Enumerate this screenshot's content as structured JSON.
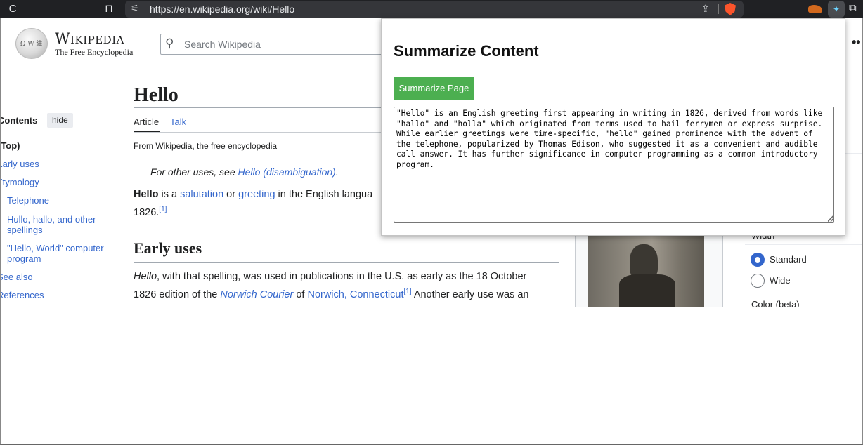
{
  "browser": {
    "url": "https://en.wikipedia.org/wiki/Hello",
    "reload_glyph": "C",
    "bookmark_glyph": "⊓",
    "tune_glyph": "⚟",
    "share_glyph": "⇪",
    "ext_active_glyph": "✦",
    "puzzle_glyph": "⧉",
    "icons": [
      "reload-icon",
      "bookmark-icon",
      "site-settings-icon",
      "share-icon",
      "brave-shield-icon",
      "extension-icon",
      "puzzle-icon"
    ]
  },
  "wiki": {
    "wordmark": "Wikipedia",
    "tagline": "The Free Encyclopedia",
    "search_placeholder": "Search Wikipedia",
    "more_glyph": "••",
    "toc": {
      "title": "Contents",
      "hide_label": "hide",
      "items": [
        "(Top)",
        "Early uses",
        "Etymology",
        "Telephone",
        "Hullo, hallo, and other spellings",
        "\"Hello, World\" computer program",
        "See also",
        "References"
      ]
    },
    "article": {
      "title": "Hello",
      "tab_article": "Article",
      "tab_talk": "Talk",
      "from": "From Wikipedia, the free encyclopedia",
      "hatnote_prefix": "For other uses, see ",
      "hatnote_link": "Hello (disambiguation)",
      "hatnote_suffix": ".",
      "lead_bold": "Hello",
      "lead_is": " is a ",
      "lead_link1": "salutation",
      "lead_or": " or ",
      "lead_link2": "greeting",
      "lead_rest": " in the English langua",
      "lead_year": "1826.",
      "ref1": "[1]",
      "section1": "Early uses",
      "p2_italic": "Hello",
      "p2_a": ", with that spelling, was used in publications in the U.S. as early as the 18 October",
      "p2_b": "1826 edition of the ",
      "p2_link_italic": "Norwich Courier",
      "p2_of": " of ",
      "p2_link": "Norwich, Connecticut",
      "p2_ref": "[1]",
      "p2_c": " Another early use was an"
    },
    "appearance": {
      "width_label": "Width",
      "option_standard": "Standard",
      "option_wide": "Wide",
      "color_label": "Color (beta)"
    }
  },
  "popup": {
    "title": "Summarize Content",
    "button_label": "Summarize Page",
    "summary": "\"Hello\" is an English greeting first appearing in writing in 1826, derived from words like\n\"hallo\" and \"holla\" which originated from terms used to hail ferrymen or express surprise.\nWhile earlier greetings were time-specific, \"hello\" gained prominence with the advent of\nthe telephone, popularized by Thomas Edison, who suggested it as a convenient and audible\ncall answer. It has further significance in computer programming as a common introductory\nprogram.",
    "accent_color": "#4caf50"
  }
}
